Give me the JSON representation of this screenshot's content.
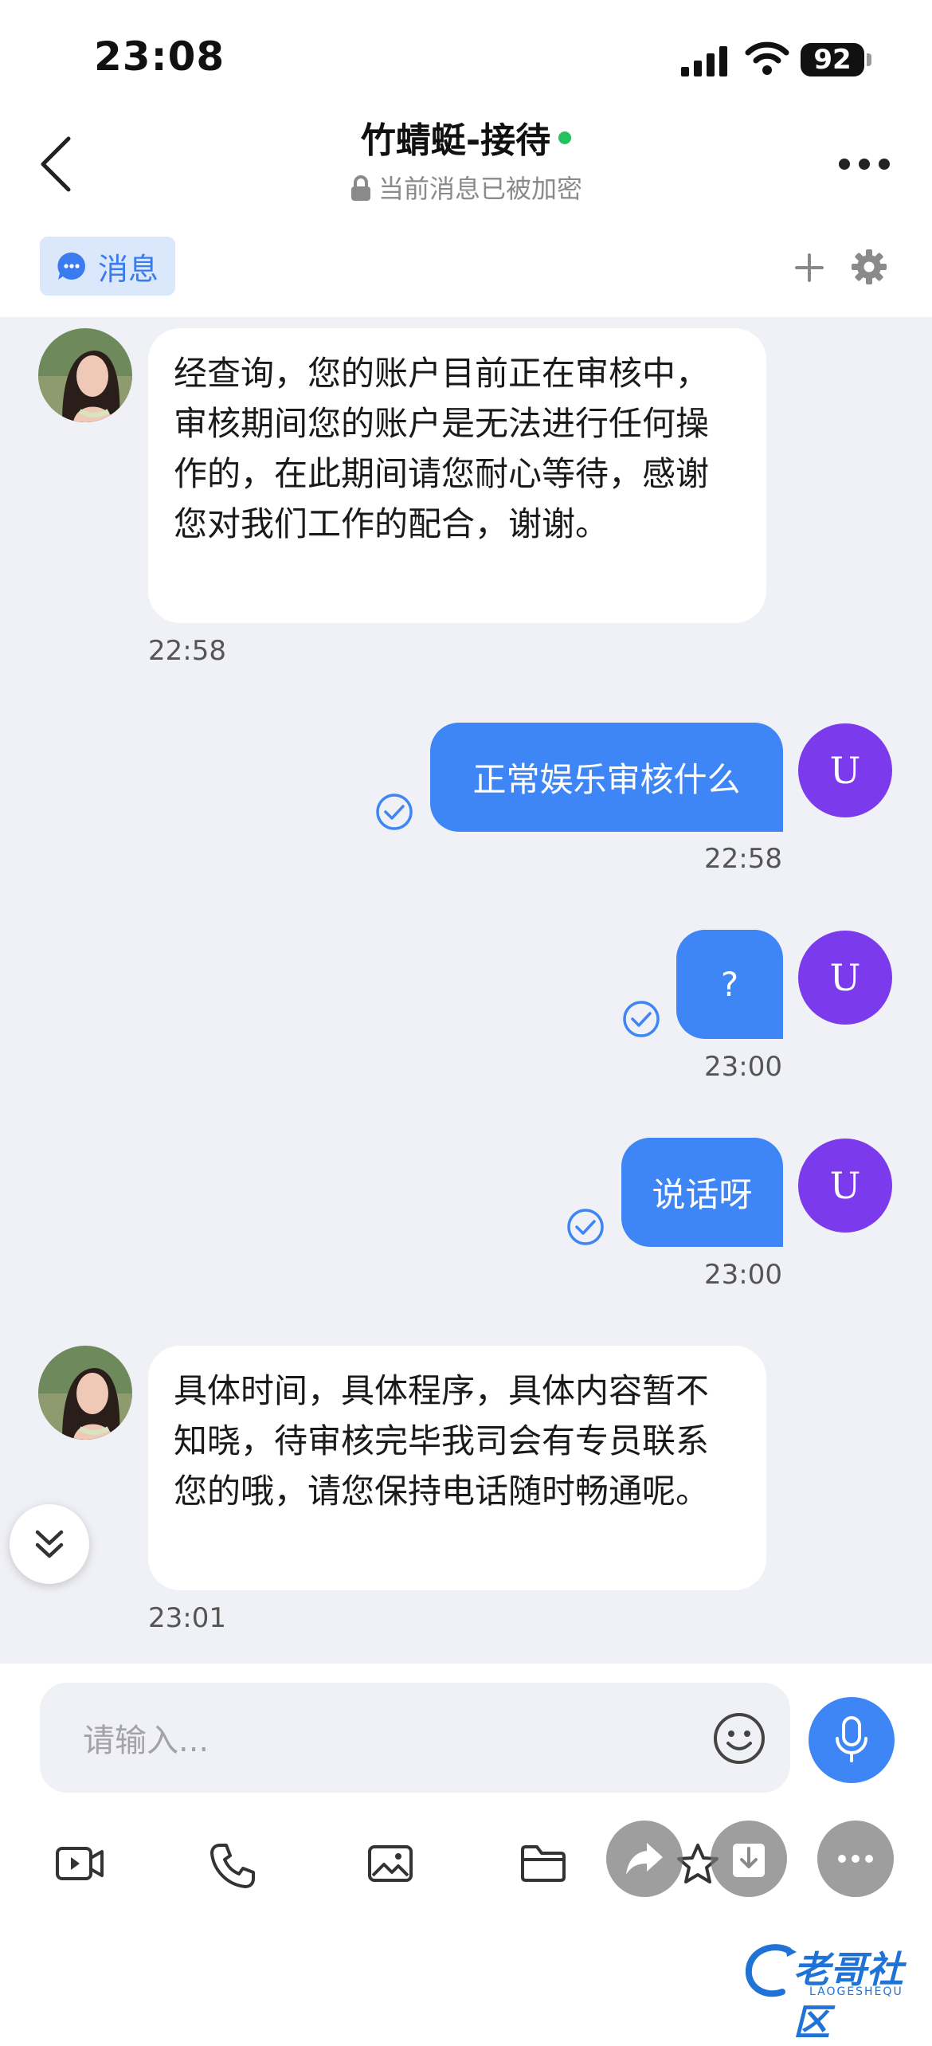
{
  "status_bar": {
    "time": "23:08",
    "battery": "92"
  },
  "header": {
    "title": "竹蜻蜓-接待",
    "encryption_notice": "当前消息已被加密"
  },
  "tabs": [
    {
      "label": "消息"
    }
  ],
  "messages": [
    {
      "direction": "in",
      "text": "经查询，您的账户目前正在审核中，审核期间您的账户是无法进行任何操作的，在此期间请您耐心等待，感谢您对我们工作的配合，谢谢。",
      "time": "22:58"
    },
    {
      "direction": "out",
      "text": "正常娱乐审核什么",
      "time": "22:58",
      "avatar_letter": "U",
      "status": "read"
    },
    {
      "direction": "out",
      "text": "?",
      "time": "23:00",
      "avatar_letter": "U",
      "status": "read"
    },
    {
      "direction": "out",
      "text": "说话呀",
      "time": "23:00",
      "avatar_letter": "U",
      "status": "read"
    },
    {
      "direction": "in",
      "text": "具体时间，具体程序，具体内容暂不知晓，待审核完毕我司会有专员联系您的哦，请您保持电话随时畅通呢。",
      "time": "23:01"
    }
  ],
  "input": {
    "placeholder": "请输入..."
  },
  "toolbar": [
    "video-icon",
    "phone-icon",
    "image-icon",
    "folder-icon",
    "star-icon"
  ],
  "floating_buttons": [
    "share-icon",
    "save-icon",
    "more-icon"
  ],
  "watermark": {
    "text": "老哥社区",
    "subtext": "LAOGESHEQU"
  },
  "colors": {
    "accent": "#3e86f5",
    "user_avatar": "#7c3aed",
    "online": "#22c35e",
    "chat_bg": "#f0f1f6"
  }
}
